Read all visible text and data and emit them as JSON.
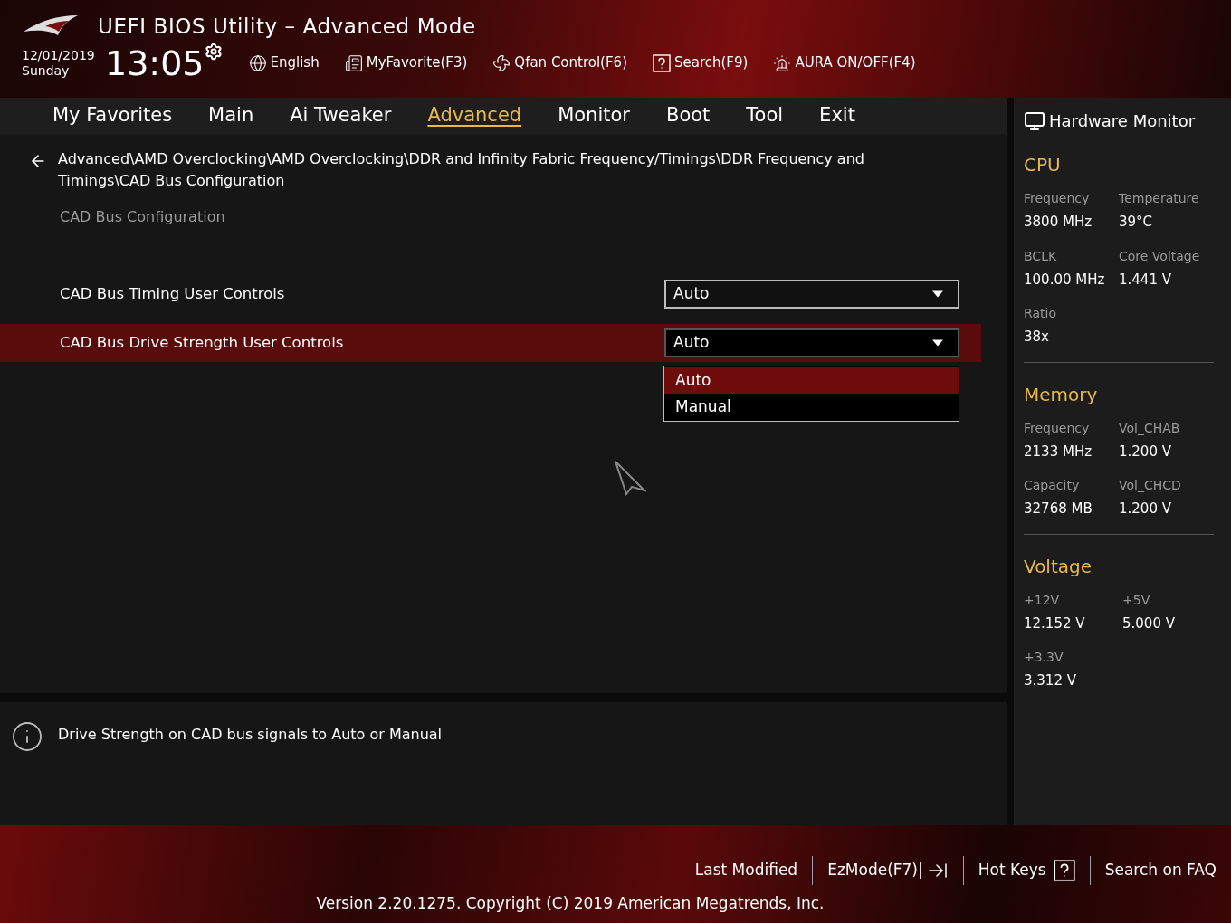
{
  "header": {
    "title": "UEFI BIOS Utility – Advanced Mode",
    "date": "12/01/2019",
    "day": "Sunday",
    "time": "13:05",
    "tools": [
      {
        "kind": "globe",
        "label": "English"
      },
      {
        "kind": "favorite",
        "label": "MyFavorite(F3)"
      },
      {
        "kind": "fan",
        "label": "Qfan Control(F6)"
      },
      {
        "kind": "search",
        "label": "Search(F9)"
      },
      {
        "kind": "aura",
        "label": "AURA ON/OFF(F4)"
      }
    ]
  },
  "tabs": [
    {
      "label": "My Favorites",
      "selected": false
    },
    {
      "label": "Main",
      "selected": false
    },
    {
      "label": "Ai Tweaker",
      "selected": false
    },
    {
      "label": "Advanced",
      "selected": true
    },
    {
      "label": "Monitor",
      "selected": false
    },
    {
      "label": "Boot",
      "selected": false
    },
    {
      "label": "Tool",
      "selected": false
    },
    {
      "label": "Exit",
      "selected": false
    }
  ],
  "breadcrumb": "Advanced\\AMD Overclocking\\AMD Overclocking\\DDR and Infinity Fabric Frequency/Timings\\DDR Frequency and Timings\\CAD Bus Configuration",
  "section_title": "CAD Bus Configuration",
  "settings": [
    {
      "label": "CAD Bus Timing User Controls",
      "value": "Auto",
      "selected": false,
      "expanded": false
    },
    {
      "label": "CAD Bus Drive Strength User Controls",
      "value": "Auto",
      "selected": true,
      "expanded": true,
      "options": [
        {
          "label": "Auto",
          "selected": true
        },
        {
          "label": "Manual",
          "selected": false
        }
      ]
    }
  ],
  "help": "Drive Strength on CAD bus signals to Auto or Manual",
  "hardware_monitor": {
    "title": "Hardware Monitor",
    "sections": [
      {
        "title": "CPU",
        "items": [
          {
            "label": "Frequency",
            "value": "3800 MHz"
          },
          {
            "label": "Temperature",
            "value": "39°C"
          },
          {
            "label": "BCLK",
            "value": "100.00 MHz"
          },
          {
            "label": "Core Voltage",
            "value": "1.441 V"
          },
          {
            "label": "Ratio",
            "value": "38x"
          }
        ]
      },
      {
        "title": "Memory",
        "items": [
          {
            "label": "Frequency",
            "value": "2133 MHz"
          },
          {
            "label": "Vol_CHAB",
            "value": "1.200 V"
          },
          {
            "label": "Capacity",
            "value": "32768 MB"
          },
          {
            "label": "Vol_CHCD",
            "value": "1.200 V"
          }
        ]
      },
      {
        "title": "Voltage",
        "items": [
          {
            "label": "+12V",
            "value": "12.152 V"
          },
          {
            "label": "+5V",
            "value": "5.000 V"
          },
          {
            "label": "+3.3V",
            "value": "3.312 V"
          }
        ]
      }
    ]
  },
  "footer": {
    "items": [
      {
        "kind": "text",
        "label": "Last Modified"
      },
      {
        "kind": "exit",
        "label": "EzMode(F7)|"
      },
      {
        "kind": "help",
        "label": "Hot Keys"
      },
      {
        "kind": "text",
        "label": "Search on FAQ"
      }
    ],
    "version": "Version 2.20.1275. Copyright (C) 2019 American Megatrends, Inc."
  }
}
